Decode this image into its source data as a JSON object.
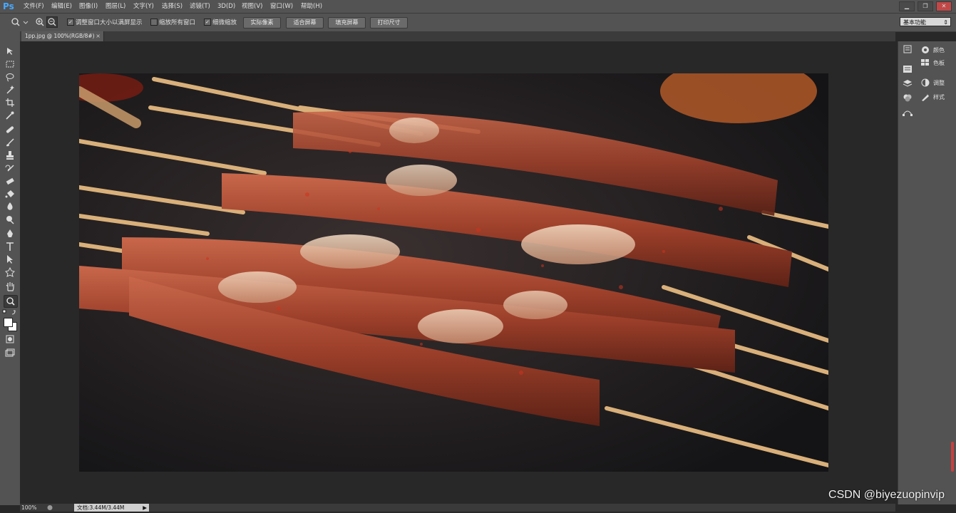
{
  "app": {
    "logo": "Ps"
  },
  "menu": [
    "文件(F)",
    "编辑(E)",
    "图像(I)",
    "图层(L)",
    "文字(Y)",
    "选择(S)",
    "滤镜(T)",
    "3D(D)",
    "视图(V)",
    "窗口(W)",
    "帮助(H)"
  ],
  "window_controls": {
    "minimize": "▁",
    "restore": "❐",
    "close": "✕"
  },
  "options": {
    "checkbox_resize": "调整窗口大小以满屏显示",
    "checkbox_zoom_all": "缩放所有窗口",
    "checkbox_scrubby": "细微缩放",
    "btn_actual": "实际像素",
    "btn_fit": "适合屏幕",
    "btn_fill": "填充屏幕",
    "btn_print": "打印尺寸",
    "workspace": "基本功能"
  },
  "document_tab": {
    "title": "1pp.jpg @ 100%(RGB/8#)",
    "close": "×"
  },
  "panels": [
    {
      "icon": "color-icon",
      "label": "颜色"
    },
    {
      "icon": "swatches-icon",
      "label": "色板"
    },
    {
      "icon": "adjustments-icon",
      "label": "调整"
    },
    {
      "icon": "styles-icon",
      "label": "样式"
    }
  ],
  "status": {
    "zoom": "100%",
    "doc_info": "文档:3.44M/3.44M"
  },
  "watermark": "CSDN @biyezuopinvip",
  "colors": {
    "ps_blue": "#47a8ff",
    "panel_bg": "#535353",
    "canvas_bg": "#282828"
  }
}
